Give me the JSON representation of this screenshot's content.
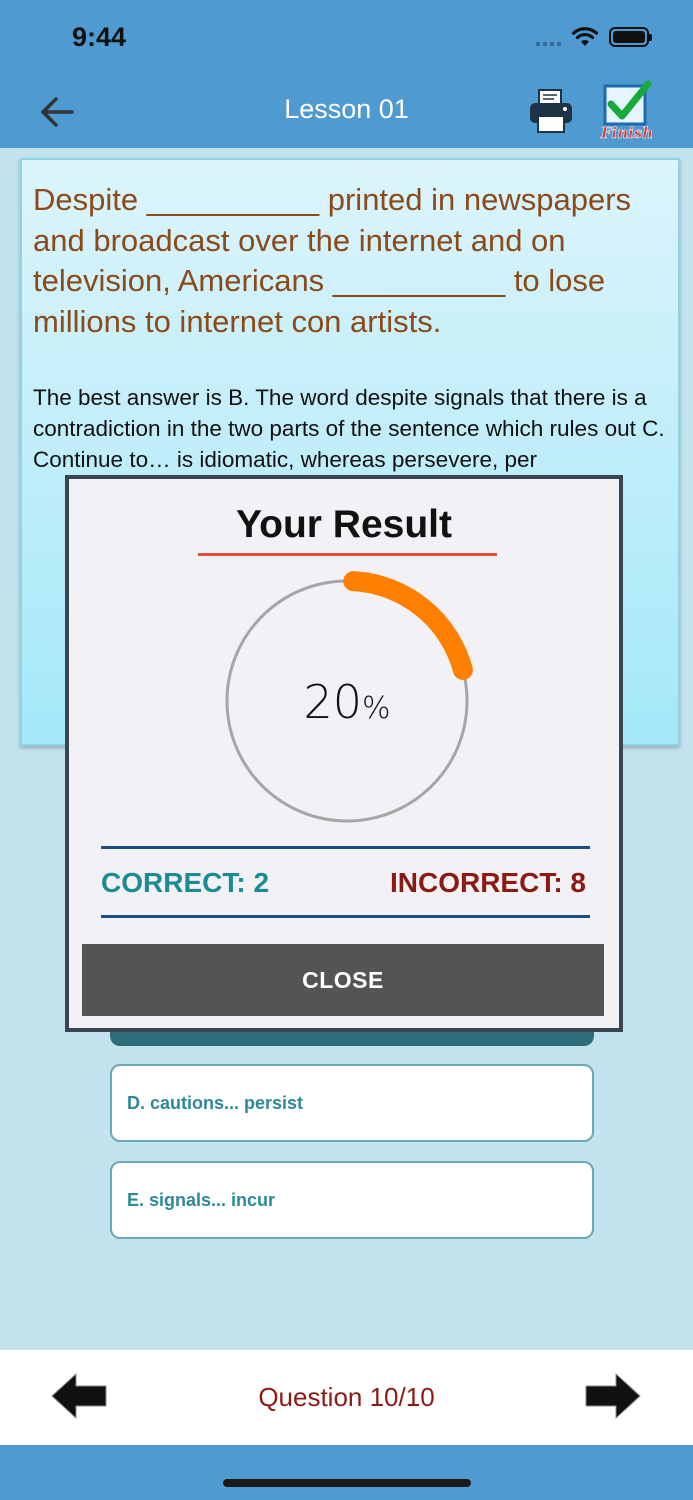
{
  "status_bar": {
    "time": "9:44"
  },
  "header": {
    "title": "Lesson 01",
    "finish_label": "Finish"
  },
  "question": {
    "text": "Despite __________ printed in newspapers and broadcast over the internet and on television, Americans __________ to lose millions to internet con artists.",
    "explanation": "The best answer is B. The word despite signals that there is a contradiction in the two parts of the sentence which rules out C. Continue to… is idiomatic, whereas persevere, per"
  },
  "options": [
    {
      "label": "D. cautions... persist"
    },
    {
      "label": "E. signals... incur"
    }
  ],
  "result_modal": {
    "title": "Your Result",
    "percent": 20,
    "percent_value": "20",
    "percent_sign": "%",
    "correct_label": "CORRECT: 2",
    "incorrect_label": "INCORRECT: 8",
    "close_label": "CLOSE",
    "colors": {
      "progress": "#ff8000",
      "track": "#a6a6a6",
      "underline": "#e74c3c"
    }
  },
  "footer": {
    "question_counter": "Question 10/10"
  }
}
